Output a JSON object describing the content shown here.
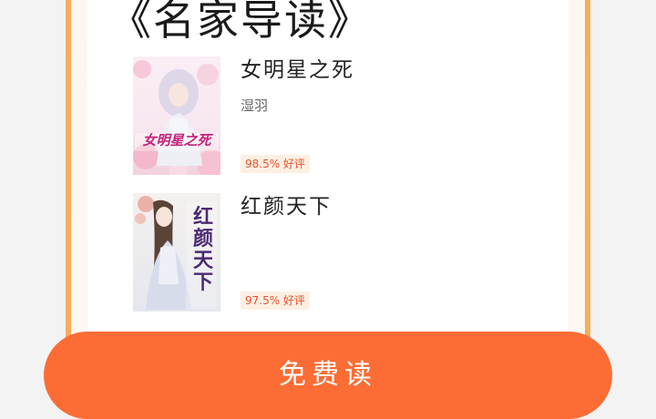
{
  "section": {
    "title": "《名家导读》"
  },
  "books": [
    {
      "title": "女明星之死",
      "author": "湿羽",
      "rating": "98.5% 好评",
      "cover_text": "女明星之死"
    },
    {
      "title": "红颜天下",
      "author": "",
      "rating": "97.5% 好评",
      "cover_text": "红颜天下"
    }
  ],
  "cta": {
    "label": "免费读"
  },
  "colors": {
    "accent": "#fb6d35",
    "frame": "#f7ad5b",
    "rating_text": "#e8512e",
    "rating_bg": "#fdf0e3"
  }
}
